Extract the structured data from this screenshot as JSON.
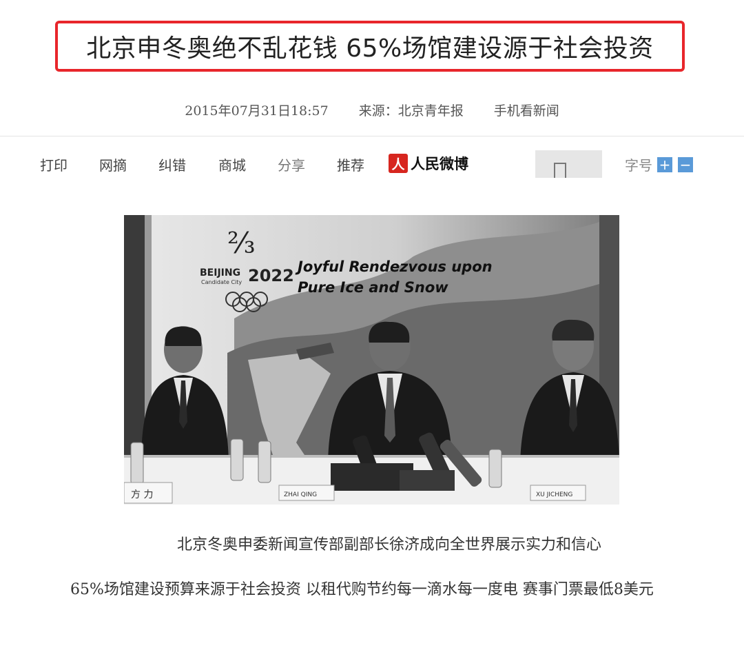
{
  "headline": "北京申冬奥绝不乱花钱 65%场馆建设源于社会投资",
  "meta": {
    "datetime": "2015年07月31日18:57",
    "source": "来源：北京青年报",
    "mobile_link": "手机看新闻"
  },
  "toolbar": {
    "print": "打印",
    "excerpt": "网摘",
    "correct": "纠错",
    "mall": "商城",
    "share": "分享",
    "recommend": "推荐",
    "weibo_logo": "人",
    "weibo_label": "人民微博",
    "font_size_label": "字号",
    "font_plus": "+",
    "font_minus": "−"
  },
  "photo": {
    "logo_text": "BEIJING",
    "logo_sub": "Candidate City",
    "logo_year": "2022",
    "banner_line1": "Joyful Rendezvous upon",
    "banner_line2": "Pure Ice and Snow",
    "nameplate_left": "方 力",
    "nameplate_center": "ZHAI QING",
    "nameplate_right": "XU JICHENG"
  },
  "caption": "北京冬奥申委新闻宣传部副部长徐济成向全世界展示实力和信心",
  "lead_paragraph": "65%场馆建设预算来源于社会投资  以租代购节约每一滴水每一度电  赛事门票最低8美元"
}
